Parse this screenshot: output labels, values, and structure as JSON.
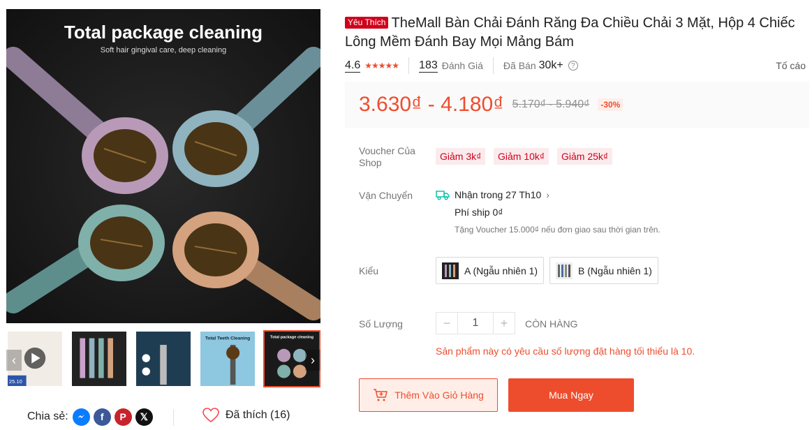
{
  "gallery": {
    "main_image_headline": "Total package cleaning",
    "main_image_subline": "Soft hair gingival care, deep cleaning",
    "thumb_labels": [
      "25.10",
      "",
      "",
      "Total Teeth Cleaning",
      "Total package cleaning"
    ],
    "arrow_left": "‹",
    "arrow_right": "›"
  },
  "share": {
    "label": "Chia sẻ:",
    "icons": [
      "messenger-icon",
      "facebook-icon",
      "pinterest-icon",
      "x-icon"
    ],
    "like_label": "Đã thích (16)"
  },
  "product": {
    "badge": "Yêu Thích",
    "title": "TheMall Bàn Chải Đánh Răng Đa Chiều Chải 3 Mặt, Hộp 4 Chiếc Lông Mềm Đánh Bay Mọi Mảng Bám",
    "rating": "4.6",
    "stars": "★★★★★",
    "review_count": "183",
    "review_label": "Đánh Giá",
    "sold_label": "Đã Bán",
    "sold_count": "30k+",
    "report": "Tố cáo"
  },
  "price": {
    "current": "3.630₫ - 4.180₫",
    "original": "5.170₫ - 5.940₫",
    "discount": "-30%"
  },
  "vouchers": {
    "label": "Voucher Của Shop",
    "items": [
      "Giảm 3k₫",
      "Giảm 10k₫",
      "Giảm 25k₫"
    ]
  },
  "shipping": {
    "label": "Vận Chuyển",
    "eta": "Nhận trong 27 Th10",
    "fee": "Phí ship 0₫",
    "note": "Tặng Voucher 15.000₫ nếu đơn giao sau thời gian trên."
  },
  "variants": {
    "label": "Kiểu",
    "options": [
      "A (Ngẫu nhiên 1)",
      "B (Ngẫu nhiên 1)"
    ]
  },
  "quantity": {
    "label": "Số Lượng",
    "value": "1",
    "minus": "−",
    "plus": "+",
    "stock": "CÒN HÀNG",
    "min_note": "Sản phẩm này có yêu cầu số lượng đặt hàng tối thiểu là 10."
  },
  "actions": {
    "add_to_cart": "Thêm Vào Giỏ Hàng",
    "buy_now": "Mua Ngay"
  },
  "colors": {
    "accent": "#ee4d2d",
    "badge": "#d0011b"
  }
}
